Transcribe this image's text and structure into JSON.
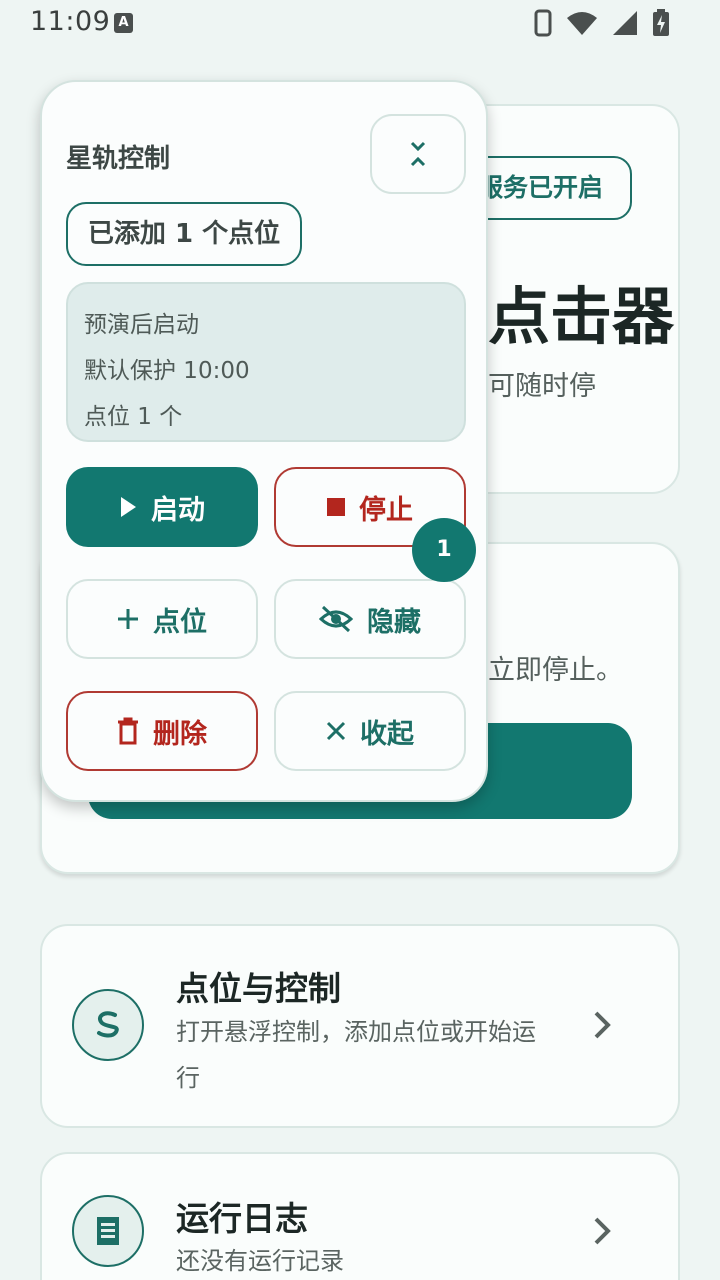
{
  "status_bar": {
    "time": "11:09",
    "notification_letter": "A",
    "icons": [
      "phone-icon",
      "wifi-icon",
      "signal-icon",
      "battery-charging-icon"
    ]
  },
  "main": {
    "service_badge": "服务已开启",
    "title_fragment": "点击器",
    "subtitle_fragment": "可随时停",
    "card2_text_fragment": "立即停止。"
  },
  "nav": [
    {
      "icon": "route-icon",
      "title": "点位与控制",
      "desc": "打开悬浮控制，添加点位或开始运行"
    },
    {
      "icon": "log-icon",
      "title": "运行日志",
      "desc": "还没有运行记录"
    }
  ],
  "panel": {
    "title": "星轨控制",
    "count_chip": "已添加 1 个点位",
    "info": {
      "mode": "预演后启动",
      "protection": "默认保护  10:00",
      "points": "点位  1  个"
    },
    "buttons": {
      "start": "启动",
      "stop": "停止",
      "add": "点位",
      "hide": "隐藏",
      "delete": "删除",
      "fold": "收起"
    }
  },
  "point_marker": "1",
  "colors": {
    "accent": "#127870",
    "danger": "#b3261e",
    "background": "#eef5f3"
  }
}
